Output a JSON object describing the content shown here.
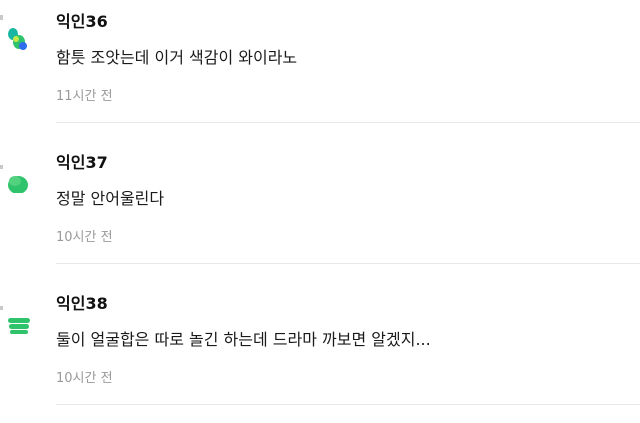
{
  "comments": [
    {
      "author": "익인36",
      "text": "함틋 조앗는데 이거 색감이 와이라노",
      "time": "11시간 전",
      "avatar_icon": "colorful-dots-avatar-icon"
    },
    {
      "author": "익인37",
      "text": "정말 안어울린다",
      "time": "10시간 전",
      "avatar_icon": "green-blob-avatar-icon"
    },
    {
      "author": "익인38",
      "text": "둘이 얼굴합은 따로 놀긴 하는데 드라마 까보면 알겠지...",
      "time": "10시간 전",
      "avatar_icon": "green-stack-avatar-icon"
    }
  ],
  "colors": {
    "avatar_green": "#2fc36b",
    "avatar_teal": "#19b7a2",
    "avatar_blue": "#2e6cf0",
    "avatar_lime": "#c6e94a",
    "meta_gray": "#9a9a9a",
    "divider": "#e8e8e8"
  }
}
